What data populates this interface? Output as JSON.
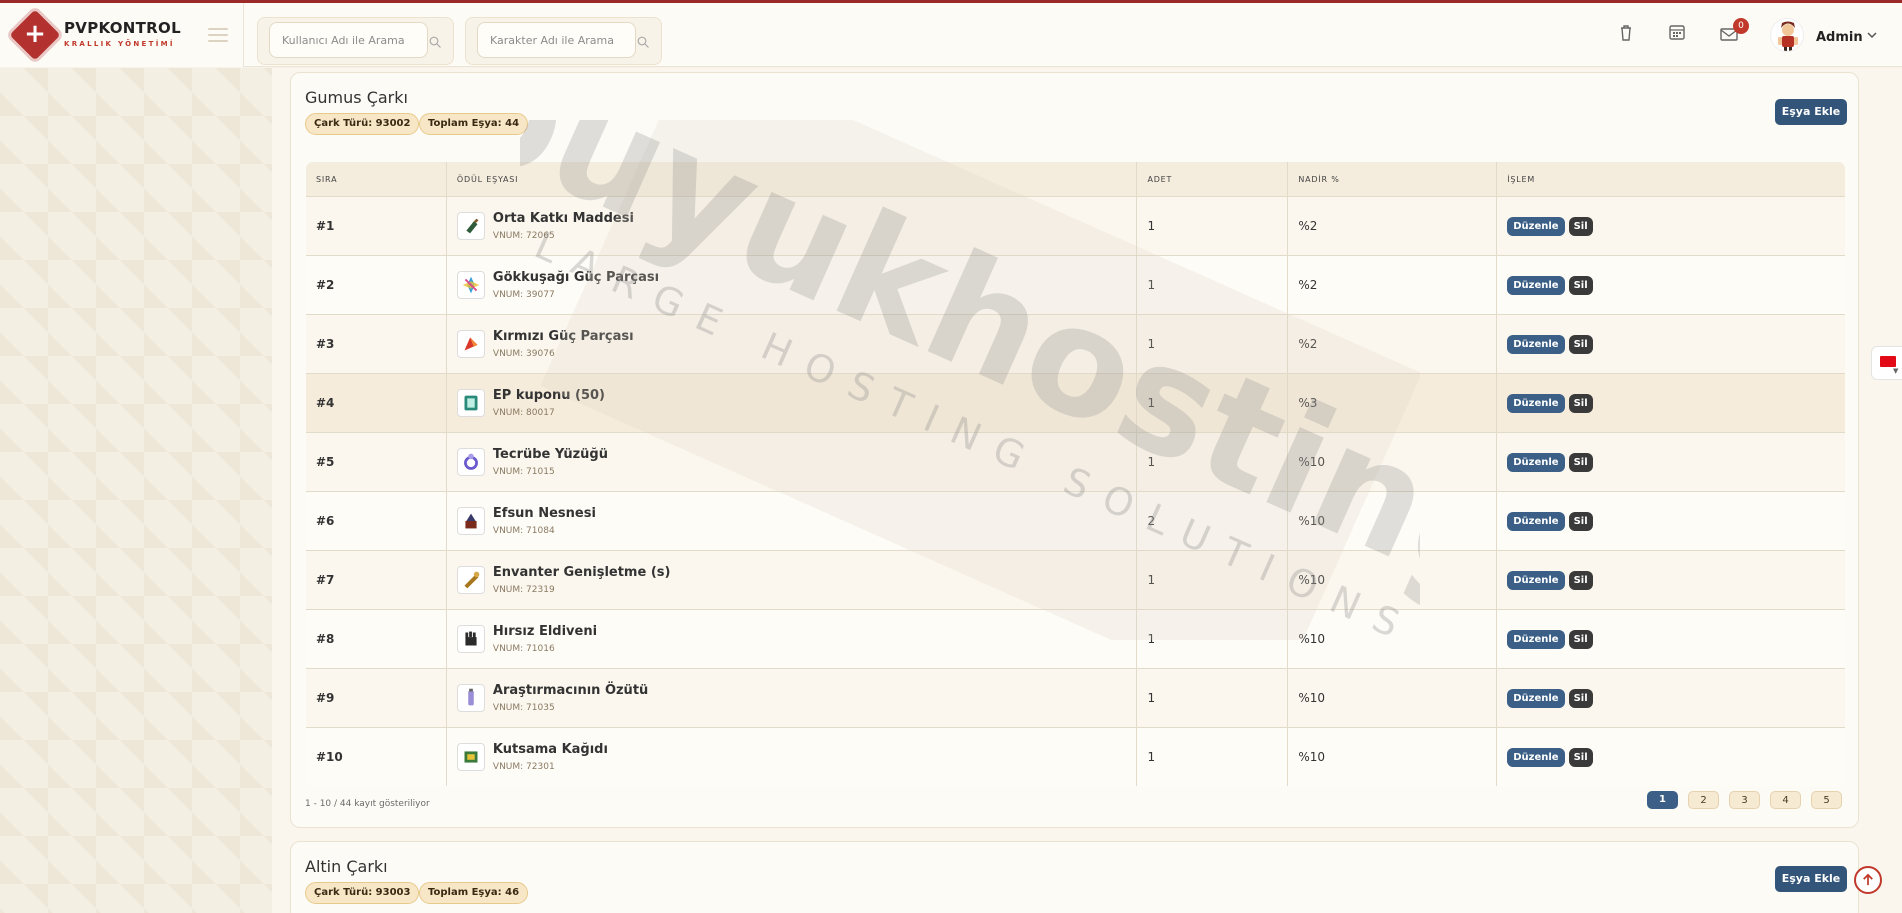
{
  "header": {
    "brand_name": "PVPKONTROL",
    "brand_sub": "KRALLIK YÖNETİMİ",
    "search_user_placeholder": "Kullanıcı Adı ile Arama",
    "search_char_placeholder": "Karakter Adı ile Arama",
    "mail_badge": "0",
    "admin_name": "Admin",
    "icons": [
      "trash-icon",
      "calendar-icon",
      "mail-icon",
      "avatar",
      "chevron-down-icon"
    ]
  },
  "wheel1": {
    "title": "Gumus Çarkı",
    "type_pill": "Çark Türü: 93002",
    "total_pill": "Toplam Eşya: 44",
    "add_button": "Eşya Ekle",
    "columns": [
      "SIRA",
      "ÖDÜL EŞYASI",
      "ADET",
      "NADİR %",
      "İŞLEM"
    ],
    "rows": [
      {
        "rank": "#1",
        "name": "Orta Katkı Maddesi",
        "vnum": "VNUM: 72065",
        "count": "1",
        "rare": "%2"
      },
      {
        "rank": "#2",
        "name": "Gökkuşağı Güç Parçası",
        "vnum": "VNUM: 39077",
        "count": "1",
        "rare": "%2"
      },
      {
        "rank": "#3",
        "name": "Kırmızı Güç Parçası",
        "vnum": "VNUM: 39076",
        "count": "1",
        "rare": "%2"
      },
      {
        "rank": "#4",
        "name": "EP kuponu (50)",
        "vnum": "VNUM: 80017",
        "count": "1",
        "rare": "%3"
      },
      {
        "rank": "#5",
        "name": "Tecrübe Yüzüğü",
        "vnum": "VNUM: 71015",
        "count": "1",
        "rare": "%10"
      },
      {
        "rank": "#6",
        "name": "Efsun Nesnesi",
        "vnum": "VNUM: 71084",
        "count": "2",
        "rare": "%10"
      },
      {
        "rank": "#7",
        "name": "Envanter Genişletme (s)",
        "vnum": "VNUM: 72319",
        "count": "1",
        "rare": "%10"
      },
      {
        "rank": "#8",
        "name": "Hırsız Eldiveni",
        "vnum": "VNUM: 71016",
        "count": "1",
        "rare": "%10"
      },
      {
        "rank": "#9",
        "name": "Araştırmacının Özütü",
        "vnum": "VNUM: 71035",
        "count": "1",
        "rare": "%10"
      },
      {
        "rank": "#10",
        "name": "Kutsama Kağıdı",
        "vnum": "VNUM: 72301",
        "count": "1",
        "rare": "%10"
      }
    ],
    "edit_label": "Düzenle",
    "delete_label": "Sil",
    "footer_info": "1 - 10 / 44 kayıt gösteriliyor",
    "pages": [
      "1",
      "2",
      "3",
      "4",
      "5"
    ],
    "active_page": "1"
  },
  "wheel2": {
    "title": "Altin Çarkı",
    "type_pill": "Çark Türü: 93003",
    "total_pill": "Toplam Eşya: 46",
    "add_button": "Eşya Ekle"
  },
  "watermark": {
    "brand": "buyukhosting",
    "tagline": "LARGE HOSTING SOLUTIONS"
  },
  "colors": {
    "accent_red": "#9c2a28",
    "primary_blue": "#3b5f86",
    "pill_bg": "#f7e7c6"
  }
}
